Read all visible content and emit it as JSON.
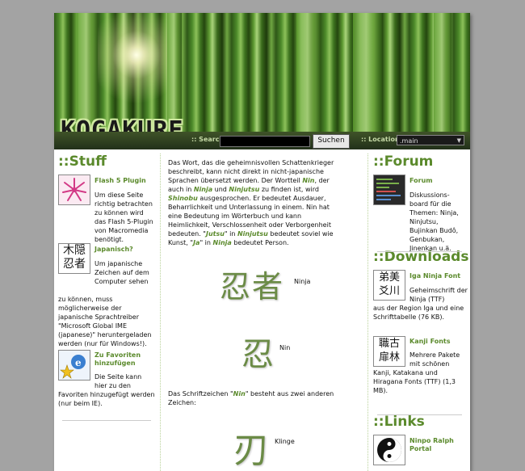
{
  "header": {
    "logo": "KOGAKURE"
  },
  "nav": {
    "search_label": ":: Search",
    "search_button": "Suchen",
    "location_label": ":: Location",
    "location_value": ".main"
  },
  "stuff": {
    "title": "::Stuff",
    "items": [
      {
        "title": "Flash 5 Plugin",
        "desc": "Um diese Seite richtig betrachten zu können wird das Flash 5-Plugin von Macromedia benötigt."
      },
      {
        "title": "Japanisch?",
        "desc": "Um japanische Zeichen auf dem Computer sehen zu können, muss möglicherweise der japanische Sprachtreiber \"Microsoft Global IME (japanese)\" heruntergeladen werden (nur für Windows!)."
      },
      {
        "title": "Zu Favoriten hinzufügen",
        "desc": "Die Seite kann hier zu den Favoriten hinzugefügt werden (nur beim IE)."
      }
    ]
  },
  "main": {
    "p1_a": "Das Wort, das die geheimnisvollen Schattenkrieger beschreibt, kann nicht direkt in nicht-japanische Sprachen übersetzt werden. Der Wortteil ",
    "p1_nin": "Nin",
    "p1_b": ", der auch in ",
    "p1_ninja": "Ninja",
    "p1_c": " und ",
    "p1_ninjutsu": "Ninjutsu",
    "p1_d": " zu finden ist, wird ",
    "p1_shinobu": "Shinobu",
    "p1_e": " ausgesprochen. Er bedeutet Ausdauer, Beharrlichkeit und Unterlassung in einem. Nin hat eine Bedeutung im Wörterbuch und kann Heimlichkeit, Verschlossenheit oder Verborgenheit bedeuten. \"",
    "p1_jutsu": "Jutsu",
    "p1_f": "\" in ",
    "p1_ninjutsu2": "Ninjutsu",
    "p1_g": " bedeutet soviel wie Kunst, \"",
    "p1_ja": "Ja",
    "p1_h": "\" in ",
    "p1_ninja2": "Ninja",
    "p1_i": " bedeutet Person.",
    "kanji": [
      {
        "glyph": "忍者",
        "label": "Ninja"
      },
      {
        "glyph": "忍",
        "label": "Nin"
      },
      {
        "glyph": "刃",
        "label": "Klinge"
      }
    ],
    "p2_a": "Das Schriftzeichen \"",
    "p2_nin": "Nin",
    "p2_b": "\" besteht aus zwei anderen Zeichen:"
  },
  "forum": {
    "title": "::Forum",
    "item": {
      "title": "Forum",
      "desc": "Diskussions-board für die Themen: Ninja, Ninjutsu, Bujinkan Budô, Genbukan, Jinenkan u.ä."
    }
  },
  "downloads": {
    "title": "::Downloads",
    "items": [
      {
        "title": "Iga Ninja Font",
        "desc": "Geheimschrift der Ninja (TTF) aus der Region Iga und eine Schrifttabelle (76 KB)."
      },
      {
        "title": "Kanji Fonts",
        "desc": "Mehrere Pakete mit schönen Kanji, Katakana und Hiragana Fonts (TTF) (1,3 MB)."
      }
    ]
  },
  "links": {
    "title": "::Links",
    "item": {
      "title": "Ninpo Ralph Portal"
    }
  },
  "icon_glyphs": {
    "japanisch": "木隠忍者",
    "iga": "弟美 爻川",
    "kanji_fonts": "職古 扉林"
  }
}
